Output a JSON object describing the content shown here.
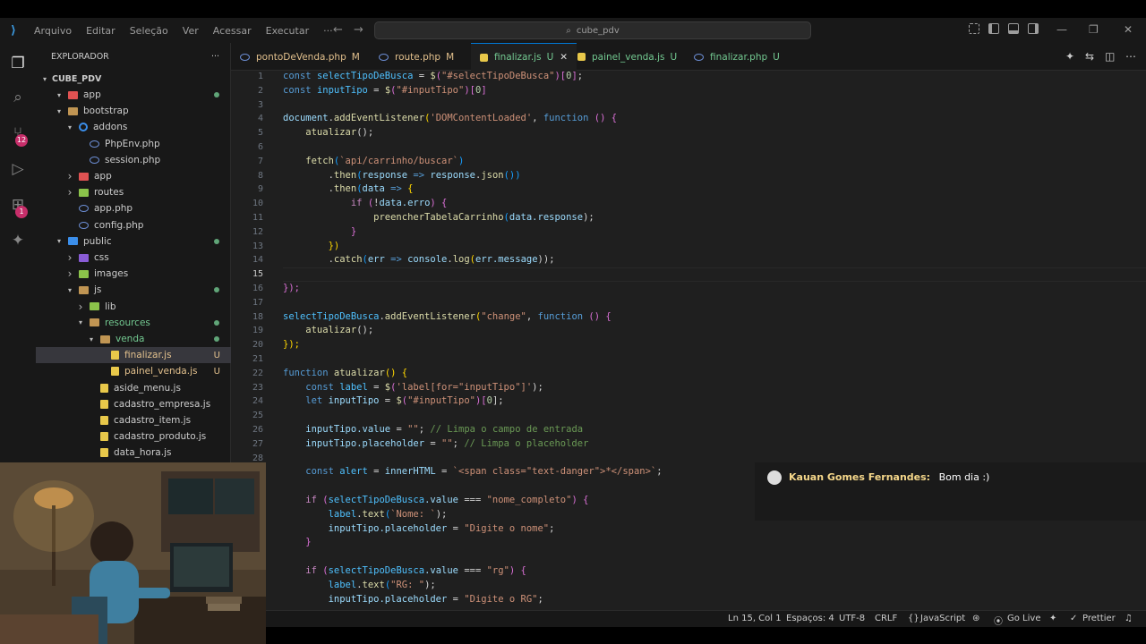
{
  "titlebar": {
    "menus": [
      "Arquivo",
      "Editar",
      "Seleção",
      "Ver",
      "Acessar",
      "Executar",
      "···"
    ],
    "search_text": "cube_pdv"
  },
  "activity_badges": {
    "source_control": "12",
    "extensions": "1"
  },
  "sidebar": {
    "header": "EXPLORADOR",
    "more": "···",
    "root": "CUBE_PDV",
    "items": [
      {
        "label": "app",
        "depth": 1,
        "open": true,
        "icon": "red",
        "dot": true
      },
      {
        "label": "bootstrap",
        "depth": 1,
        "open": true,
        "icon": "folder"
      },
      {
        "label": "addons",
        "depth": 2,
        "open": true,
        "icon": "gear"
      },
      {
        "label": "PhpEnv.php",
        "depth": 3,
        "icon": "php"
      },
      {
        "label": "session.php",
        "depth": 3,
        "icon": "php"
      },
      {
        "label": "app",
        "depth": 2,
        "open": false,
        "icon": "red"
      },
      {
        "label": "routes",
        "depth": 2,
        "open": false,
        "icon": "green"
      },
      {
        "label": "app.php",
        "depth": 2,
        "icon": "php"
      },
      {
        "label": "config.php",
        "depth": 2,
        "icon": "php"
      },
      {
        "label": "public",
        "depth": 1,
        "open": true,
        "icon": "blue",
        "dot": true
      },
      {
        "label": "css",
        "depth": 2,
        "open": false,
        "icon": "purple"
      },
      {
        "label": "images",
        "depth": 2,
        "open": false,
        "icon": "green"
      },
      {
        "label": "js",
        "depth": 2,
        "open": true,
        "icon": "folder",
        "dot": true
      },
      {
        "label": "lib",
        "depth": 3,
        "open": false,
        "icon": "green"
      },
      {
        "label": "resources",
        "depth": 3,
        "open": true,
        "icon": "folder",
        "dot": true,
        "color": "#73c991"
      },
      {
        "label": "venda",
        "depth": 4,
        "open": true,
        "icon": "folder",
        "dot": true,
        "color": "#73c991"
      },
      {
        "label": "finalizar.js",
        "depth": 5,
        "icon": "jsf",
        "status": "U",
        "selected": true,
        "color": "#e2c08d"
      },
      {
        "label": "painel_venda.js",
        "depth": 5,
        "icon": "jsf",
        "status": "U",
        "color": "#e2c08d"
      },
      {
        "label": "aside_menu.js",
        "depth": 4,
        "icon": "jsf"
      },
      {
        "label": "cadastro_empresa.js",
        "depth": 4,
        "icon": "jsf"
      },
      {
        "label": "cadastro_item.js",
        "depth": 4,
        "icon": "jsf"
      },
      {
        "label": "cadastro_produto.js",
        "depth": 4,
        "icon": "jsf"
      },
      {
        "label": "data_hora.js",
        "depth": 4,
        "icon": "jsf"
      }
    ]
  },
  "tabs": [
    {
      "label": "pontoDeVenda.php",
      "status": "M",
      "icon": "php",
      "color": "#e2c08d"
    },
    {
      "label": "route.php",
      "status": "M",
      "icon": "php",
      "color": "#e2c08d"
    },
    {
      "label": "finalizar.js",
      "status": "U",
      "icon": "js",
      "active": true,
      "color": "#73c991"
    },
    {
      "label": "painel_venda.js",
      "status": "U",
      "icon": "js",
      "color": "#73c991"
    },
    {
      "label": "finalizar.php",
      "status": "U",
      "icon": "php",
      "color": "#73c991"
    }
  ],
  "code_lines": [
    {
      "n": 1,
      "t": [
        [
          "const ",
          "#569cd6"
        ],
        [
          "selectTipoDeBusca",
          "#4fc1ff"
        ],
        [
          " = ",
          "#d4d4d4"
        ],
        [
          "$",
          "#dcdcaa"
        ],
        [
          "(",
          "#da70d6"
        ],
        [
          "\"#selectTipoDeBusca\"",
          "#ce9178"
        ],
        [
          ")",
          "#da70d6"
        ],
        [
          "[",
          "#da70d6"
        ],
        [
          "0",
          "#b5cea8"
        ],
        [
          "]",
          "#da70d6"
        ],
        [
          ";",
          "#d4d4d4"
        ]
      ]
    },
    {
      "n": 2,
      "t": [
        [
          "const ",
          "#569cd6"
        ],
        [
          "inputTipo",
          "#4fc1ff"
        ],
        [
          " = ",
          "#d4d4d4"
        ],
        [
          "$",
          "#dcdcaa"
        ],
        [
          "(",
          "#da70d6"
        ],
        [
          "\"#inputTipo\"",
          "#ce9178"
        ],
        [
          ")",
          "#da70d6"
        ],
        [
          "[",
          "#da70d6"
        ],
        [
          "0",
          "#b5cea8"
        ],
        [
          "]",
          "#da70d6"
        ]
      ]
    },
    {
      "n": 3,
      "t": []
    },
    {
      "n": 4,
      "t": [
        [
          "document",
          "#9cdcfe"
        ],
        [
          ".",
          "#d4d4d4"
        ],
        [
          "addEventListener",
          "#dcdcaa"
        ],
        [
          "(",
          "#ffd700"
        ],
        [
          "'DOMContentLoaded'",
          "#ce9178"
        ],
        [
          ", ",
          "#d4d4d4"
        ],
        [
          "function ",
          "#569cd6"
        ],
        [
          "() {",
          "#da70d6"
        ]
      ]
    },
    {
      "n": 5,
      "t": [
        [
          "    atualizar",
          "#dcdcaa"
        ],
        [
          "();",
          "#d4d4d4"
        ]
      ]
    },
    {
      "n": 6,
      "t": []
    },
    {
      "n": 7,
      "t": [
        [
          "    fetch",
          "#dcdcaa"
        ],
        [
          "(",
          "#179fff"
        ],
        [
          "`api/carrinho/buscar`",
          "#ce9178"
        ],
        [
          ")",
          "#179fff"
        ]
      ]
    },
    {
      "n": 8,
      "t": [
        [
          "        .",
          "#d4d4d4"
        ],
        [
          "then",
          "#dcdcaa"
        ],
        [
          "(",
          "#179fff"
        ],
        [
          "response",
          "#9cdcfe"
        ],
        [
          " => ",
          "#569cd6"
        ],
        [
          "response",
          "#9cdcfe"
        ],
        [
          ".",
          "#d4d4d4"
        ],
        [
          "json",
          "#dcdcaa"
        ],
        [
          "())",
          "#179fff"
        ]
      ]
    },
    {
      "n": 9,
      "t": [
        [
          "        .",
          "#d4d4d4"
        ],
        [
          "then",
          "#dcdcaa"
        ],
        [
          "(",
          "#179fff"
        ],
        [
          "data",
          "#9cdcfe"
        ],
        [
          " => ",
          "#569cd6"
        ],
        [
          "{",
          "#ffd700"
        ]
      ]
    },
    {
      "n": 10,
      "t": [
        [
          "            if ",
          "#c586c0"
        ],
        [
          "(",
          "#da70d6"
        ],
        [
          "!",
          "#d4d4d4"
        ],
        [
          "data",
          "#9cdcfe"
        ],
        [
          ".erro",
          "#9cdcfe"
        ],
        [
          ") {",
          "#da70d6"
        ]
      ]
    },
    {
      "n": 11,
      "t": [
        [
          "                preencherTabelaCarrinho",
          "#dcdcaa"
        ],
        [
          "(",
          "#179fff"
        ],
        [
          "data",
          "#9cdcfe"
        ],
        [
          ".response",
          "#9cdcfe"
        ],
        [
          ");",
          "#d4d4d4"
        ]
      ]
    },
    {
      "n": 12,
      "t": [
        [
          "            }",
          "#da70d6"
        ]
      ]
    },
    {
      "n": 13,
      "t": [
        [
          "        })",
          "#ffd700"
        ]
      ]
    },
    {
      "n": 14,
      "t": [
        [
          "        .",
          "#d4d4d4"
        ],
        [
          "catch",
          "#dcdcaa"
        ],
        [
          "(",
          "#179fff"
        ],
        [
          "err",
          "#9cdcfe"
        ],
        [
          " => ",
          "#569cd6"
        ],
        [
          "console",
          "#9cdcfe"
        ],
        [
          ".",
          "#d4d4d4"
        ],
        [
          "log",
          "#dcdcaa"
        ],
        [
          "(",
          "#ffd700"
        ],
        [
          "err",
          "#9cdcfe"
        ],
        [
          ".message",
          "#9cdcfe"
        ],
        [
          "));",
          "#d4d4d4"
        ]
      ]
    },
    {
      "n": 15,
      "t": [],
      "current": true
    },
    {
      "n": 16,
      "t": [
        [
          "});",
          "#da70d6"
        ]
      ]
    },
    {
      "n": 17,
      "t": []
    },
    {
      "n": 18,
      "t": [
        [
          "selectTipoDeBusca",
          "#4fc1ff"
        ],
        [
          ".",
          "#d4d4d4"
        ],
        [
          "addEventListener",
          "#dcdcaa"
        ],
        [
          "(",
          "#ffd700"
        ],
        [
          "\"change\"",
          "#ce9178"
        ],
        [
          ", ",
          "#d4d4d4"
        ],
        [
          "function ",
          "#569cd6"
        ],
        [
          "() {",
          "#da70d6"
        ]
      ]
    },
    {
      "n": 19,
      "t": [
        [
          "    atualizar",
          "#dcdcaa"
        ],
        [
          "();",
          "#d4d4d4"
        ]
      ]
    },
    {
      "n": 20,
      "t": [
        [
          "});",
          "#ffd700"
        ]
      ]
    },
    {
      "n": 21,
      "t": []
    },
    {
      "n": 22,
      "t": [
        [
          "function ",
          "#569cd6"
        ],
        [
          "atualizar",
          "#dcdcaa"
        ],
        [
          "() {",
          "#ffd700"
        ]
      ]
    },
    {
      "n": 23,
      "t": [
        [
          "    const ",
          "#569cd6"
        ],
        [
          "label",
          "#4fc1ff"
        ],
        [
          " = ",
          "#d4d4d4"
        ],
        [
          "$",
          "#dcdcaa"
        ],
        [
          "(",
          "#da70d6"
        ],
        [
          "'label[for=\"inputTipo\"]'",
          "#ce9178"
        ],
        [
          ");",
          "#d4d4d4"
        ]
      ]
    },
    {
      "n": 24,
      "t": [
        [
          "    let ",
          "#569cd6"
        ],
        [
          "inputTipo",
          "#9cdcfe"
        ],
        [
          " = ",
          "#d4d4d4"
        ],
        [
          "$",
          "#dcdcaa"
        ],
        [
          "(",
          "#da70d6"
        ],
        [
          "\"#inputTipo\"",
          "#ce9178"
        ],
        [
          ")",
          "#da70d6"
        ],
        [
          "[",
          "#da70d6"
        ],
        [
          "0",
          "#b5cea8"
        ],
        [
          "];",
          "#d4d4d4"
        ]
      ]
    },
    {
      "n": 25,
      "t": []
    },
    {
      "n": 26,
      "t": [
        [
          "    inputTipo",
          "#9cdcfe"
        ],
        [
          ".value",
          "#9cdcfe"
        ],
        [
          " = ",
          "#d4d4d4"
        ],
        [
          "\"\"",
          "#ce9178"
        ],
        [
          "; ",
          "#d4d4d4"
        ],
        [
          "// Limpa o campo de entrada",
          "#6a9955"
        ]
      ]
    },
    {
      "n": 27,
      "t": [
        [
          "    inputTipo",
          "#9cdcfe"
        ],
        [
          ".placeholder",
          "#9cdcfe"
        ],
        [
          " = ",
          "#d4d4d4"
        ],
        [
          "\"\"",
          "#ce9178"
        ],
        [
          "; ",
          "#d4d4d4"
        ],
        [
          "// Limpa o placeholder",
          "#6a9955"
        ]
      ]
    },
    {
      "n": 28,
      "t": []
    },
    {
      "n": 29,
      "t": [
        [
          "    const ",
          "#569cd6"
        ],
        [
          "alert",
          "#4fc1ff"
        ],
        [
          " = ",
          "#d4d4d4"
        ],
        [
          "innerHTML",
          "#9cdcfe"
        ],
        [
          " = ",
          "#d4d4d4"
        ],
        [
          "`<span class=\"text-danger\">*</span>`",
          "#ce9178"
        ],
        [
          ";",
          "#d4d4d4"
        ]
      ]
    },
    {
      "n": 30,
      "t": []
    },
    {
      "n": 31,
      "t": [
        [
          "    if ",
          "#c586c0"
        ],
        [
          "(",
          "#da70d6"
        ],
        [
          "selectTipoDeBusca",
          "#4fc1ff"
        ],
        [
          ".value",
          "#9cdcfe"
        ],
        [
          " === ",
          "#d4d4d4"
        ],
        [
          "\"nome_completo\"",
          "#ce9178"
        ],
        [
          ") {",
          "#da70d6"
        ]
      ]
    },
    {
      "n": 32,
      "t": [
        [
          "        label",
          "#4fc1ff"
        ],
        [
          ".",
          "#d4d4d4"
        ],
        [
          "text",
          "#dcdcaa"
        ],
        [
          "(",
          "#179fff"
        ],
        [
          "`Nome: `",
          "#ce9178"
        ],
        [
          ");",
          "#d4d4d4"
        ]
      ]
    },
    {
      "n": 33,
      "t": [
        [
          "        inputTipo",
          "#9cdcfe"
        ],
        [
          ".placeholder",
          "#9cdcfe"
        ],
        [
          " = ",
          "#d4d4d4"
        ],
        [
          "\"Digite o nome\"",
          "#ce9178"
        ],
        [
          ";",
          "#d4d4d4"
        ]
      ]
    },
    {
      "n": 34,
      "t": [
        [
          "    }",
          "#da70d6"
        ]
      ]
    },
    {
      "n": 35,
      "t": []
    },
    {
      "n": 36,
      "t": [
        [
          "    if ",
          "#c586c0"
        ],
        [
          "(",
          "#da70d6"
        ],
        [
          "selectTipoDeBusca",
          "#4fc1ff"
        ],
        [
          ".value",
          "#9cdcfe"
        ],
        [
          " === ",
          "#d4d4d4"
        ],
        [
          "\"rg\"",
          "#ce9178"
        ],
        [
          ") {",
          "#da70d6"
        ]
      ]
    },
    {
      "n": 37,
      "t": [
        [
          "        label",
          "#4fc1ff"
        ],
        [
          ".",
          "#d4d4d4"
        ],
        [
          "text",
          "#dcdcaa"
        ],
        [
          "(",
          "#179fff"
        ],
        [
          "\"RG: \"",
          "#ce9178"
        ],
        [
          ");",
          "#d4d4d4"
        ]
      ]
    },
    {
      "n": 38,
      "t": [
        [
          "        inputTipo",
          "#9cdcfe"
        ],
        [
          ".placeholder",
          "#9cdcfe"
        ],
        [
          " = ",
          "#d4d4d4"
        ],
        [
          "\"Digite o RG\"",
          "#ce9178"
        ],
        [
          ";",
          "#d4d4d4"
        ]
      ]
    }
  ],
  "status": {
    "position": "Ln 15, Col 1",
    "spaces": "Espaços: 4",
    "encoding": "UTF-8",
    "eol": "CRLF",
    "language": "JavaScript",
    "golive": "Go Live",
    "prettier": "Prettier"
  },
  "chat": {
    "name": "Kauan Gomes Fernandes:",
    "message": "Bom dia :)"
  }
}
